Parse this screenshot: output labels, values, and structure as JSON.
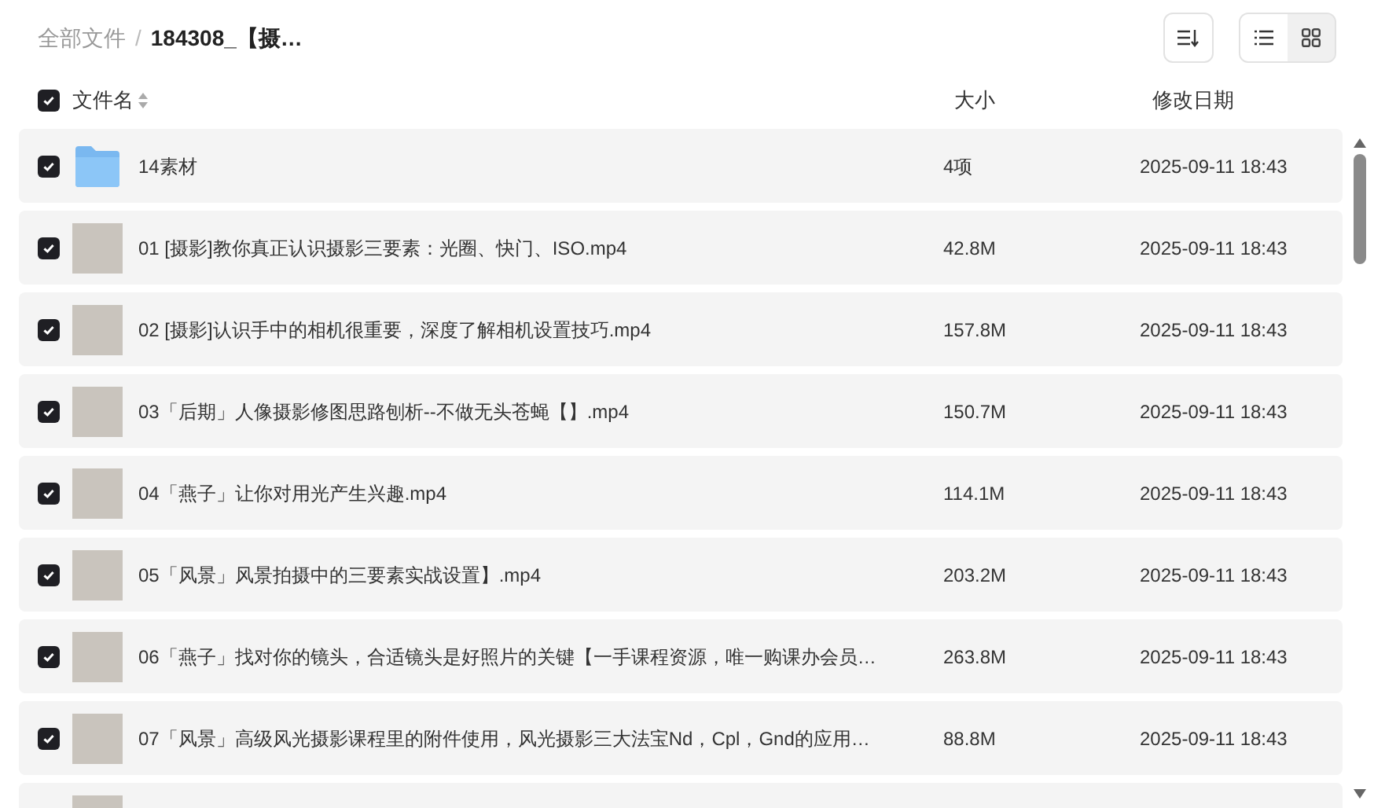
{
  "breadcrumb_separator": "/",
  "breadcrumb": [
    {
      "label": "全部文件",
      "current": false
    },
    {
      "label": "184308_【摄…",
      "current": true
    }
  ],
  "view_modes": [
    {
      "kind": "list",
      "selected": true
    },
    {
      "kind": "grid",
      "selected": false
    }
  ],
  "header": {
    "checked": true,
    "columns": [
      "文件名",
      "大小",
      "修改日期"
    ]
  },
  "rows": [
    {
      "kind": "folder",
      "checked": true,
      "name": "14素材",
      "size": "4项",
      "date": "2025-09-11 18:43"
    },
    {
      "kind": "video",
      "checked": true,
      "name": "01 [摄影]教你真正认识摄影三要素：光圈、快门、ISO.mp4",
      "size": "42.8M",
      "date": "2025-09-11 18:43"
    },
    {
      "kind": "video",
      "checked": true,
      "name": "02 [摄影]认识手中的相机很重要，深度了解相机设置技巧.mp4",
      "size": "157.8M",
      "date": "2025-09-11 18:43"
    },
    {
      "kind": "video",
      "checked": true,
      "name": "03「后期」人像摄影修图思路刨析--不做无头苍蝇【】.mp4",
      "size": "150.7M",
      "date": "2025-09-11 18:43"
    },
    {
      "kind": "video",
      "checked": true,
      "name": "04「燕子」让你对用光产生兴趣.mp4",
      "size": "114.1M",
      "date": "2025-09-11 18:43"
    },
    {
      "kind": "video",
      "checked": true,
      "name": "05「风景」风景拍摄中的三要素实战设置】.mp4",
      "size": "203.2M",
      "date": "2025-09-11 18:43"
    },
    {
      "kind": "video",
      "checked": true,
      "name": "06「燕子」找对你的镜头，合适镜头是好照片的关键【一手课程资源，唯一购课办会员…",
      "size": "263.8M",
      "date": "2025-09-11 18:43"
    },
    {
      "kind": "video",
      "checked": true,
      "name": "07「风景」高级风光摄影课程里的附件使用，风光摄影三大法宝Nd，Cpl，Gnd的应用…",
      "size": "88.8M",
      "date": "2025-09-11 18:43"
    },
    {
      "kind": "video"
    }
  ]
}
